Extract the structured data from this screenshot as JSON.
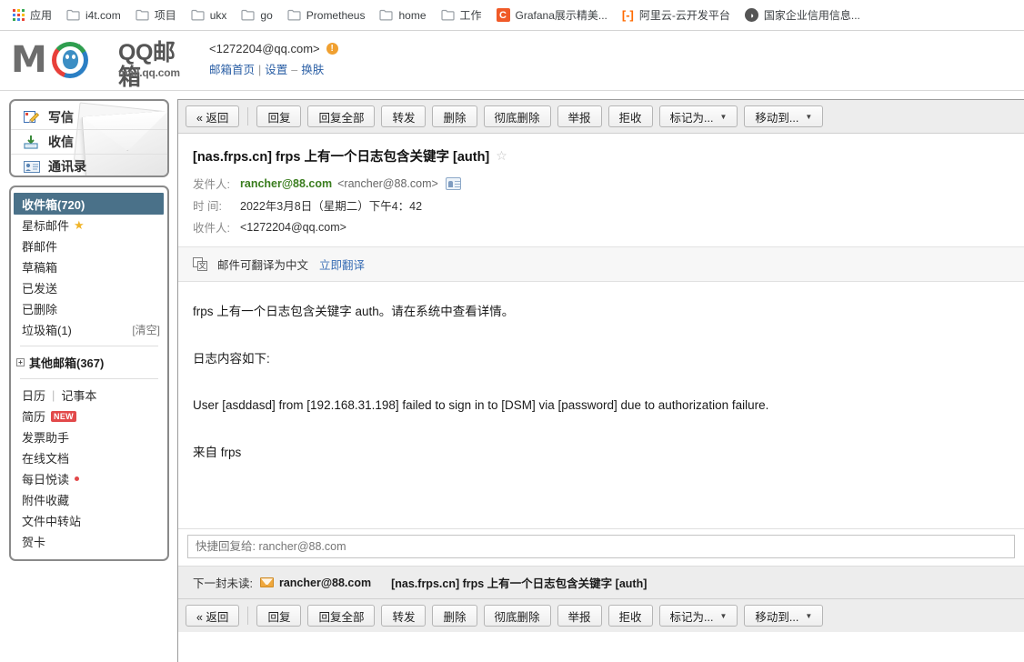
{
  "browser": {
    "bookmarks": [
      {
        "label": "应用",
        "icon": "apps-grid-icon",
        "type": "apps"
      },
      {
        "label": "i4t.com",
        "icon": "folder-icon",
        "type": "folder"
      },
      {
        "label": "项目",
        "icon": "folder-icon",
        "type": "folder"
      },
      {
        "label": "ukx",
        "icon": "folder-icon",
        "type": "folder"
      },
      {
        "label": "go",
        "icon": "folder-icon",
        "type": "folder"
      },
      {
        "label": "Prometheus",
        "icon": "folder-icon",
        "type": "folder"
      },
      {
        "label": "home",
        "icon": "folder-icon",
        "type": "folder"
      },
      {
        "label": "工作",
        "icon": "folder-icon",
        "type": "folder"
      },
      {
        "label": "Grafana展示精美...",
        "icon": "grafana-icon",
        "type": "favicon",
        "glyph": "C",
        "color": "#f05a28"
      },
      {
        "label": "阿里云-云开发平台",
        "icon": "aliyun-icon",
        "type": "favicon",
        "glyph": "[-]",
        "color": "#ff6a00"
      },
      {
        "label": "国家企业信用信息...",
        "icon": "globe-icon",
        "type": "favicon",
        "glyph": "⬤",
        "color": "#555555"
      }
    ]
  },
  "header": {
    "logo_word": "M  il",
    "logo_brand": "QQ邮箱",
    "logo_url": "mail.qq.com",
    "account_email": "<1272204@qq.com>",
    "warning_badge": "!",
    "links": {
      "home": "邮箱首页",
      "settings": "设置",
      "skin": "换肤",
      "sep1": "|",
      "sep2": "–"
    }
  },
  "sidebar": {
    "compose": [
      {
        "label": "写信",
        "icon": "compose-pencil-icon"
      },
      {
        "label": "收信",
        "icon": "receive-inbox-icon"
      },
      {
        "label": "通讯录",
        "icon": "contacts-icon"
      }
    ],
    "folders": [
      {
        "label": "收件箱(720)",
        "selected": true
      },
      {
        "label": "星标邮件",
        "star": true
      },
      {
        "label": "群邮件"
      },
      {
        "label": "草稿箱"
      },
      {
        "label": "已发送"
      },
      {
        "label": "已删除"
      },
      {
        "label": "垃圾箱(1)",
        "right": "[清空]"
      }
    ],
    "group": {
      "label": "其他邮箱(367)",
      "expander": "+"
    },
    "tools": [
      {
        "label": "日历",
        "label2": "记事本",
        "sep": "|"
      },
      {
        "label": "简历",
        "badge": "NEW"
      },
      {
        "label": "发票助手"
      },
      {
        "label": "在线文档"
      },
      {
        "label": "每日悦读",
        "dot": true
      },
      {
        "label": "附件收藏"
      },
      {
        "label": "文件中转站"
      },
      {
        "label": "贺卡"
      }
    ]
  },
  "toolbar": {
    "back": "« 返回",
    "buttons": [
      {
        "label": "回复"
      },
      {
        "label": "回复全部"
      },
      {
        "label": "转发"
      },
      {
        "label": "删除"
      },
      {
        "label": "彻底删除"
      },
      {
        "label": "举报"
      },
      {
        "label": "拒收"
      },
      {
        "label": "标记为...",
        "caret": true
      },
      {
        "label": "移动到...",
        "caret": true
      }
    ]
  },
  "mail": {
    "subject": "[nas.frps.cn] frps 上有一个日志包含关键字 [auth]",
    "star": "☆",
    "from_label": "发件人:",
    "from_name": "rancher@88.com",
    "from_address": "<rancher@88.com>",
    "time_label": "时  间:",
    "time_value": "2022年3月8日（星期二）下午4：42",
    "to_label": "收件人:",
    "to_value": "<1272204@qq.com>",
    "translate_text": "邮件可翻译为中文",
    "translate_link": "立即翻译",
    "translate_icon_front": "文",
    "body": [
      "frps 上有一个日志包含关键字 auth。请在系统中查看详情。",
      "日志内容如下:",
      "User [asddasd] from [192.168.31.198] failed to sign in to [DSM] via [password] due to authorization failure.",
      "来自 frps"
    ]
  },
  "quick_reply": {
    "placeholder": "快捷回复给: rancher@88.com"
  },
  "next_unread": {
    "label": "下一封未读:",
    "address": "rancher@88.com",
    "subject": "[nas.frps.cn] frps 上有一个日志包含关键字 [auth]"
  },
  "colors": {
    "selected_folder_bg": "#4a7189",
    "from_name": "#3a7d1e",
    "link": "#3b6fb5",
    "badge_new": "#e2494a",
    "warning": "#f0a030",
    "envelope": "#f0a83c"
  }
}
